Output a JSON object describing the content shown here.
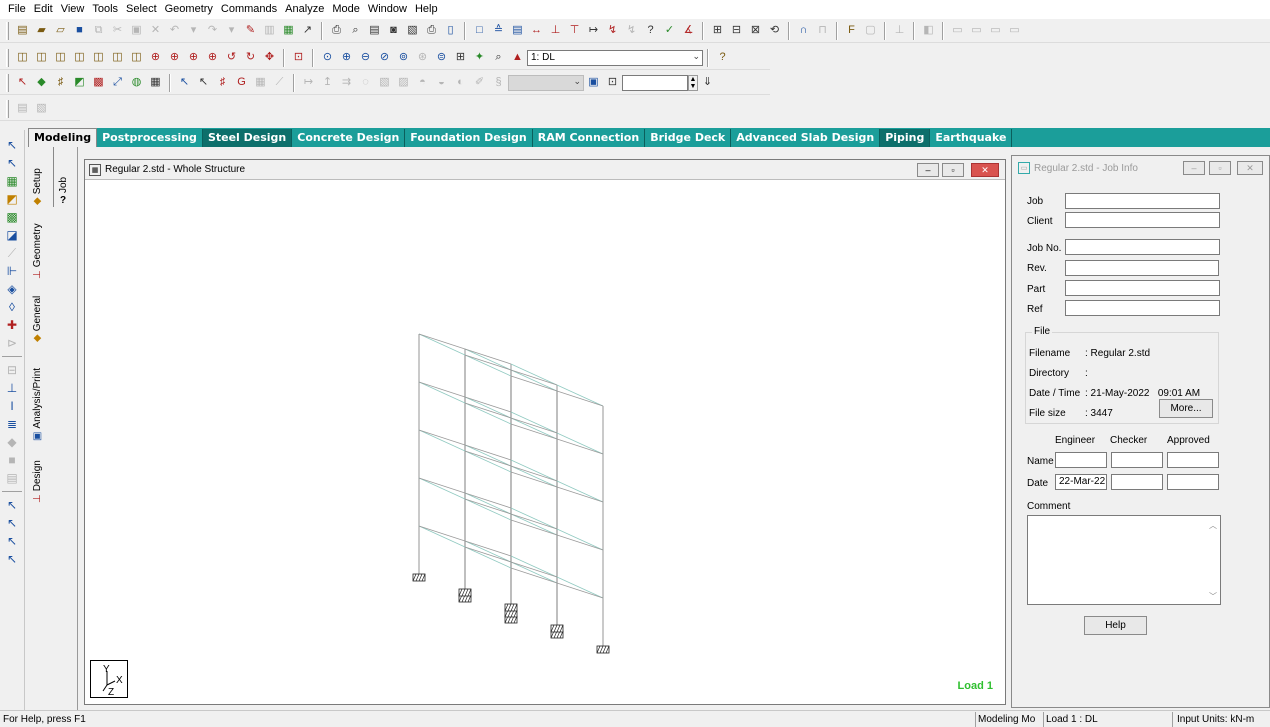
{
  "menu": [
    "File",
    "Edit",
    "View",
    "Tools",
    "Select",
    "Geometry",
    "Commands",
    "Analyze",
    "Mode",
    "Window",
    "Help"
  ],
  "toolbar": {
    "load_case_value": "1: DL",
    "help_icon": "?"
  },
  "modes": {
    "tabs": [
      "Modeling",
      "Postprocessing",
      "Steel Design",
      "Concrete Design",
      "Foundation Design",
      "RAM Connection",
      "Bridge Deck",
      "Advanced Slab Design",
      "Piping",
      "Earthquake"
    ],
    "active": "Modeling"
  },
  "page_tabs": {
    "job": "Job",
    "job_sub": "?",
    "setup": "Setup",
    "geometry": "Geometry",
    "general": "General",
    "analysis": "Analysis/Print",
    "design": "Design"
  },
  "viewport": {
    "title": "Regular 2.std - Whole Structure",
    "load_label": "Load 1",
    "axis_y": "Y",
    "axis_x": "X",
    "axis_z": "Z"
  },
  "job_info": {
    "title": "Regular 2.std - Job Info",
    "labels": {
      "job": "Job",
      "client": "Client",
      "job_no": "Job No.",
      "rev": "Rev.",
      "part": "Part",
      "ref": "Ref",
      "file_group": "File",
      "filename": "Filename",
      "directory": "Directory",
      "date_time": "Date / Time",
      "file_size": "File size",
      "engineer": "Engineer",
      "checker": "Checker",
      "approved": "Approved",
      "name": "Name",
      "date": "Date",
      "comment": "Comment"
    },
    "values": {
      "filename": ": Regular 2.std",
      "directory": ":",
      "date_time": ": 21-May-2022   09:01 AM",
      "file_size": ": 3447",
      "engineer_date": "22-Mar-22"
    },
    "buttons": {
      "more": "More...",
      "help": "Help"
    }
  },
  "status": {
    "help_text": "For Help, press F1",
    "mode": "Modeling Mo",
    "load": "Load 1 : DL",
    "units": "Input Units:  kN-m"
  }
}
